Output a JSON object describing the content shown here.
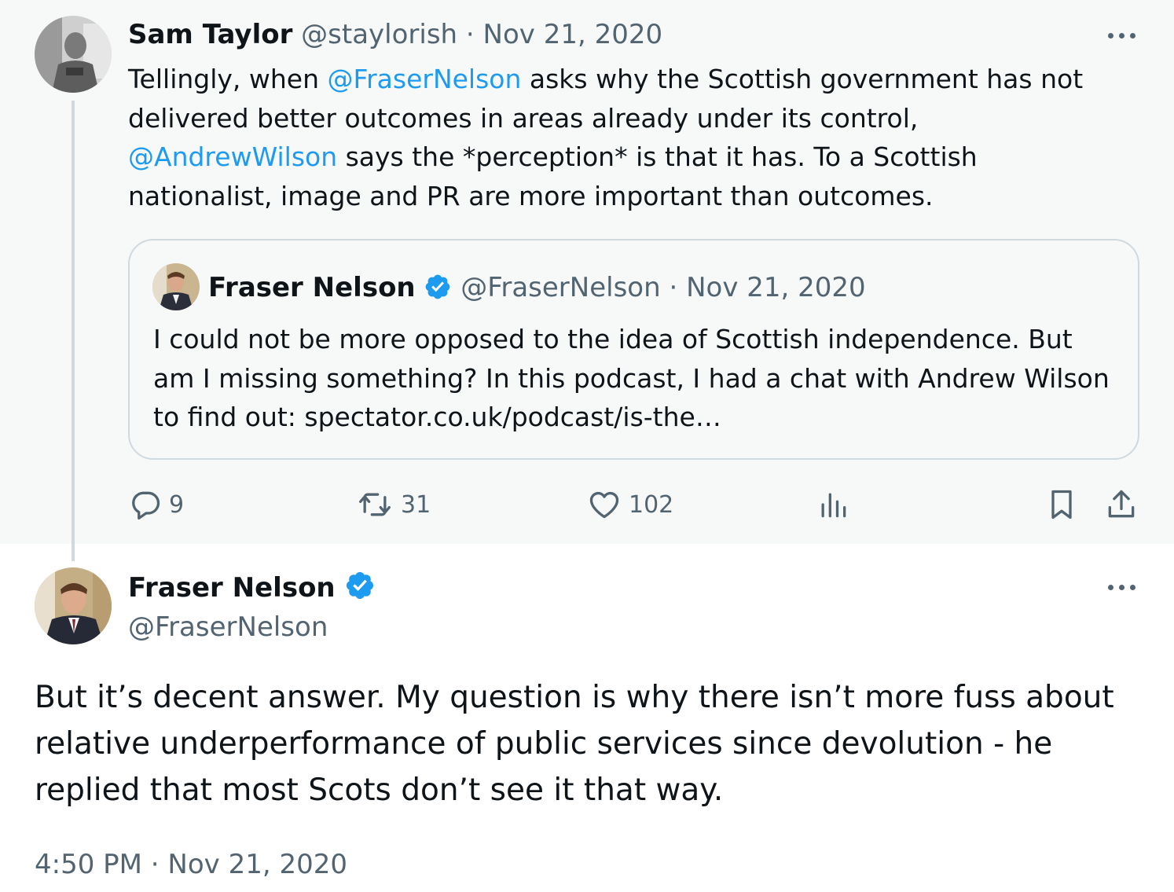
{
  "parent": {
    "name": "Sam Taylor",
    "handle": "@staylorish",
    "sep": "·",
    "date": "Nov 21, 2020",
    "text_1": "Tellingly, when ",
    "mention_1": "@FraserNelson",
    "text_2": " asks why the Scottish government has not delivered better outcomes in areas already under its control, ",
    "mention_2": "@AndrewWilson",
    "text_3": " says the *perception* is that it has. To a Scottish nationalist, image and PR are more important than outcomes.",
    "actions": {
      "replies": "9",
      "retweets": "31",
      "likes": "102"
    }
  },
  "quote": {
    "name": "Fraser Nelson",
    "handle": "@FraserNelson",
    "sep": "·",
    "date": "Nov 21, 2020",
    "text": "I could not be more opposed to the idea of Scottish independence. But am I missing something? In this podcast, I had a chat with Andrew Wilson to find out: spectator.co.uk/podcast/is-the…"
  },
  "main": {
    "name": "Fraser Nelson",
    "handle": "@FraserNelson",
    "text": "But it’s decent answer. My question is why there isn’t more fuss about relative underperformance of public services since devolution - he replied that most Scots don’t see it that way.",
    "timestamp": "4:50 PM · Nov 21, 2020"
  },
  "icons": {
    "reply": "reply-icon",
    "retweet": "retweet-icon",
    "like": "heart-icon",
    "views": "views-icon",
    "bookmark": "bookmark-icon",
    "share": "share-icon",
    "verified": "verified-badge-icon",
    "more": "more-options-icon"
  },
  "colors": {
    "accent": "#1d9bf0",
    "muted": "#536471",
    "text": "#0f1419",
    "parent_bg": "#f7f9f9",
    "border": "#cfd9de"
  }
}
